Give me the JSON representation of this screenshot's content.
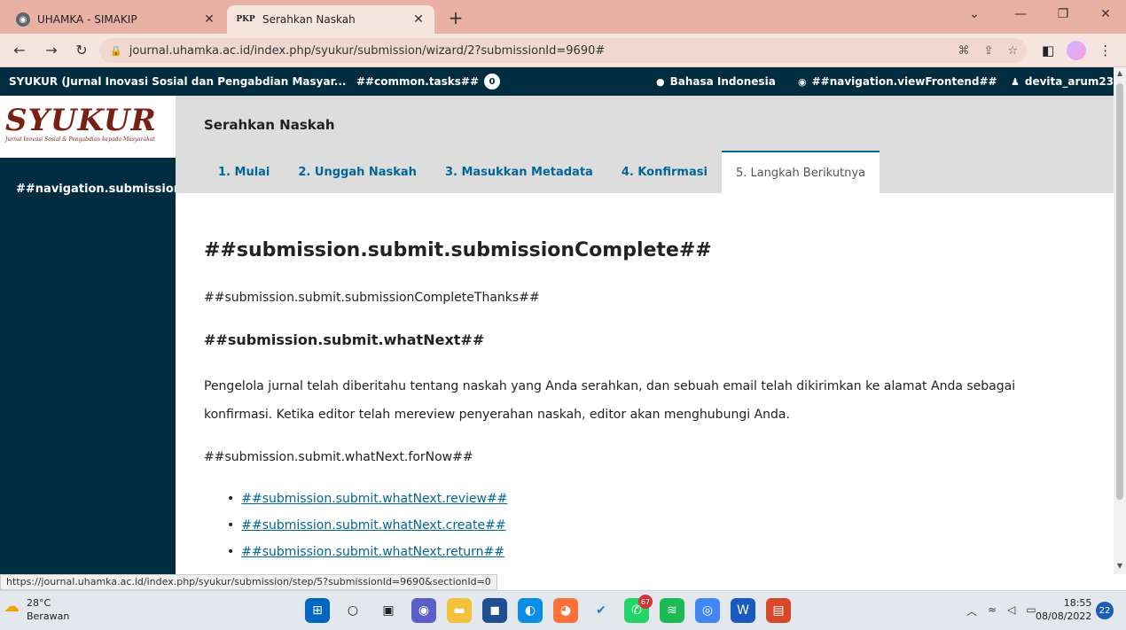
{
  "browser": {
    "tabs": [
      {
        "title": "UHAMKA - SIMAKIP",
        "favicon": "globe-icon"
      },
      {
        "title": "Serahkan Naskah",
        "favicon": "PKP"
      }
    ],
    "new_tab": "+",
    "url": "journal.uhamka.ac.id/index.php/syukur/submission/wizard/2?submissionId=9690#"
  },
  "appnav": {
    "journal_title": "SYUKUR (Jurnal Inovasi Sosial dan Pengabdian Masyar...",
    "tasks_label": "##common.tasks##",
    "tasks_count": "0",
    "language": "Bahasa Indonesia",
    "view_frontend": "##navigation.viewFrontend##",
    "user": "devita_arum23"
  },
  "sidebar": {
    "logo_text": "SYUKUR",
    "logo_subtitle": "Jurnal Inovasi Sosial & Pengabdian kepada Masyarakat",
    "items": [
      {
        "label": "##navigation.submissions##"
      }
    ]
  },
  "main": {
    "page_title": "Serahkan Naskah",
    "tabs": [
      {
        "label": "1. Mulai"
      },
      {
        "label": "2. Unggah Naskah"
      },
      {
        "label": "3. Masukkan Metadata"
      },
      {
        "label": "4. Konfirmasi"
      },
      {
        "label": "5. Langkah Berikutnya"
      }
    ],
    "heading": "##submission.submit.submissionComplete##",
    "thanks": "##submission.submit.submissionCompleteThanks##",
    "what_next_heading": "##submission.submit.whatNext##",
    "notice": "Pengelola jurnal telah diberitahu tentang naskah yang Anda serahkan, dan sebuah email telah dikirimkan ke alamat Anda sebagai konfirmasi. Ketika editor telah mereview penyerahan naskah, editor akan menghubungi Anda.",
    "for_now": "##submission.submit.whatNext.forNow##",
    "links": [
      {
        "label": "##submission.submit.whatNext.review##"
      },
      {
        "label": "##submission.submit.whatNext.create##"
      },
      {
        "label": "##submission.submit.whatNext.return##"
      }
    ]
  },
  "status_url": "https://journal.uhamka.ac.id/index.php/syukur/submission/step/5?submissionId=9690&sectionId=0",
  "taskbar": {
    "weather_temp": "28°C",
    "weather_desc": "Berawan",
    "whatsapp_badge": "67",
    "time": "18:55",
    "date": "08/08/2022",
    "notifications": "22"
  },
  "colors": {
    "app_nav": "#002c40",
    "link": "#006798",
    "tab_strip": "#e8b1a4"
  }
}
